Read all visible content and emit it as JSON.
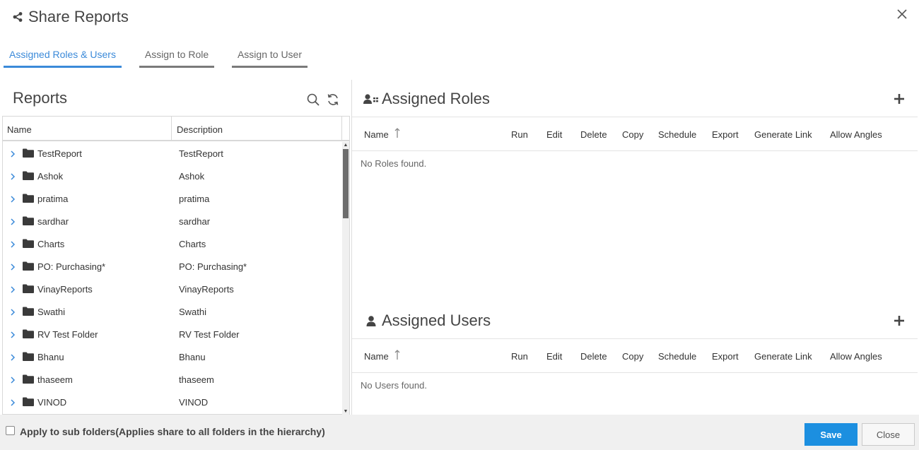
{
  "dialog": {
    "title": "Share Reports",
    "title_icon": "share-icon",
    "close_icon": "close-icon"
  },
  "tabs": [
    {
      "label": "Assigned Roles & Users",
      "active": true
    },
    {
      "label": "Assign to Role",
      "active": false
    },
    {
      "label": "Assign to User",
      "active": false
    }
  ],
  "reports": {
    "title": "Reports",
    "search_icon": "search-icon",
    "refresh_icon": "refresh-icon",
    "columns": {
      "name": "Name",
      "description": "Description"
    },
    "rows": [
      {
        "name": "TestReport",
        "description": "TestReport"
      },
      {
        "name": "Ashok",
        "description": "Ashok"
      },
      {
        "name": "pratima",
        "description": "pratima"
      },
      {
        "name": "sardhar",
        "description": "sardhar"
      },
      {
        "name": "Charts",
        "description": "Charts"
      },
      {
        "name": "PO: Purchasing*",
        "description": "PO: Purchasing*"
      },
      {
        "name": "VinayReports",
        "description": "VinayReports"
      },
      {
        "name": "Swathi",
        "description": "Swathi"
      },
      {
        "name": "RV Test Folder",
        "description": "RV Test Folder"
      },
      {
        "name": "Bhanu",
        "description": "Bhanu"
      },
      {
        "name": "thaseem",
        "description": "thaseem"
      },
      {
        "name": "VINOD",
        "description": "VINOD"
      }
    ]
  },
  "assigned_roles": {
    "title": "Assigned Roles",
    "icon": "user-role-icon",
    "empty_text": "No Roles found.",
    "columns": [
      "Name",
      "Run",
      "Edit",
      "Delete",
      "Copy",
      "Schedule",
      "Export",
      "Generate Link",
      "Allow Angles"
    ]
  },
  "assigned_users": {
    "title": "Assigned Users",
    "icon": "user-icon",
    "empty_text": "No Users found.",
    "columns": [
      "Name",
      "Run",
      "Edit",
      "Delete",
      "Copy",
      "Schedule",
      "Export",
      "Generate Link",
      "Allow Angles"
    ]
  },
  "footer": {
    "apply_sub_folders_label": "Apply to sub folders(Applies share to all folders in the hierarchy)",
    "apply_sub_folders_checked": false,
    "save_label": "Save",
    "close_label": "Close"
  },
  "colors": {
    "accent": "#3b8ad9",
    "save_button": "#1c8fe0"
  }
}
